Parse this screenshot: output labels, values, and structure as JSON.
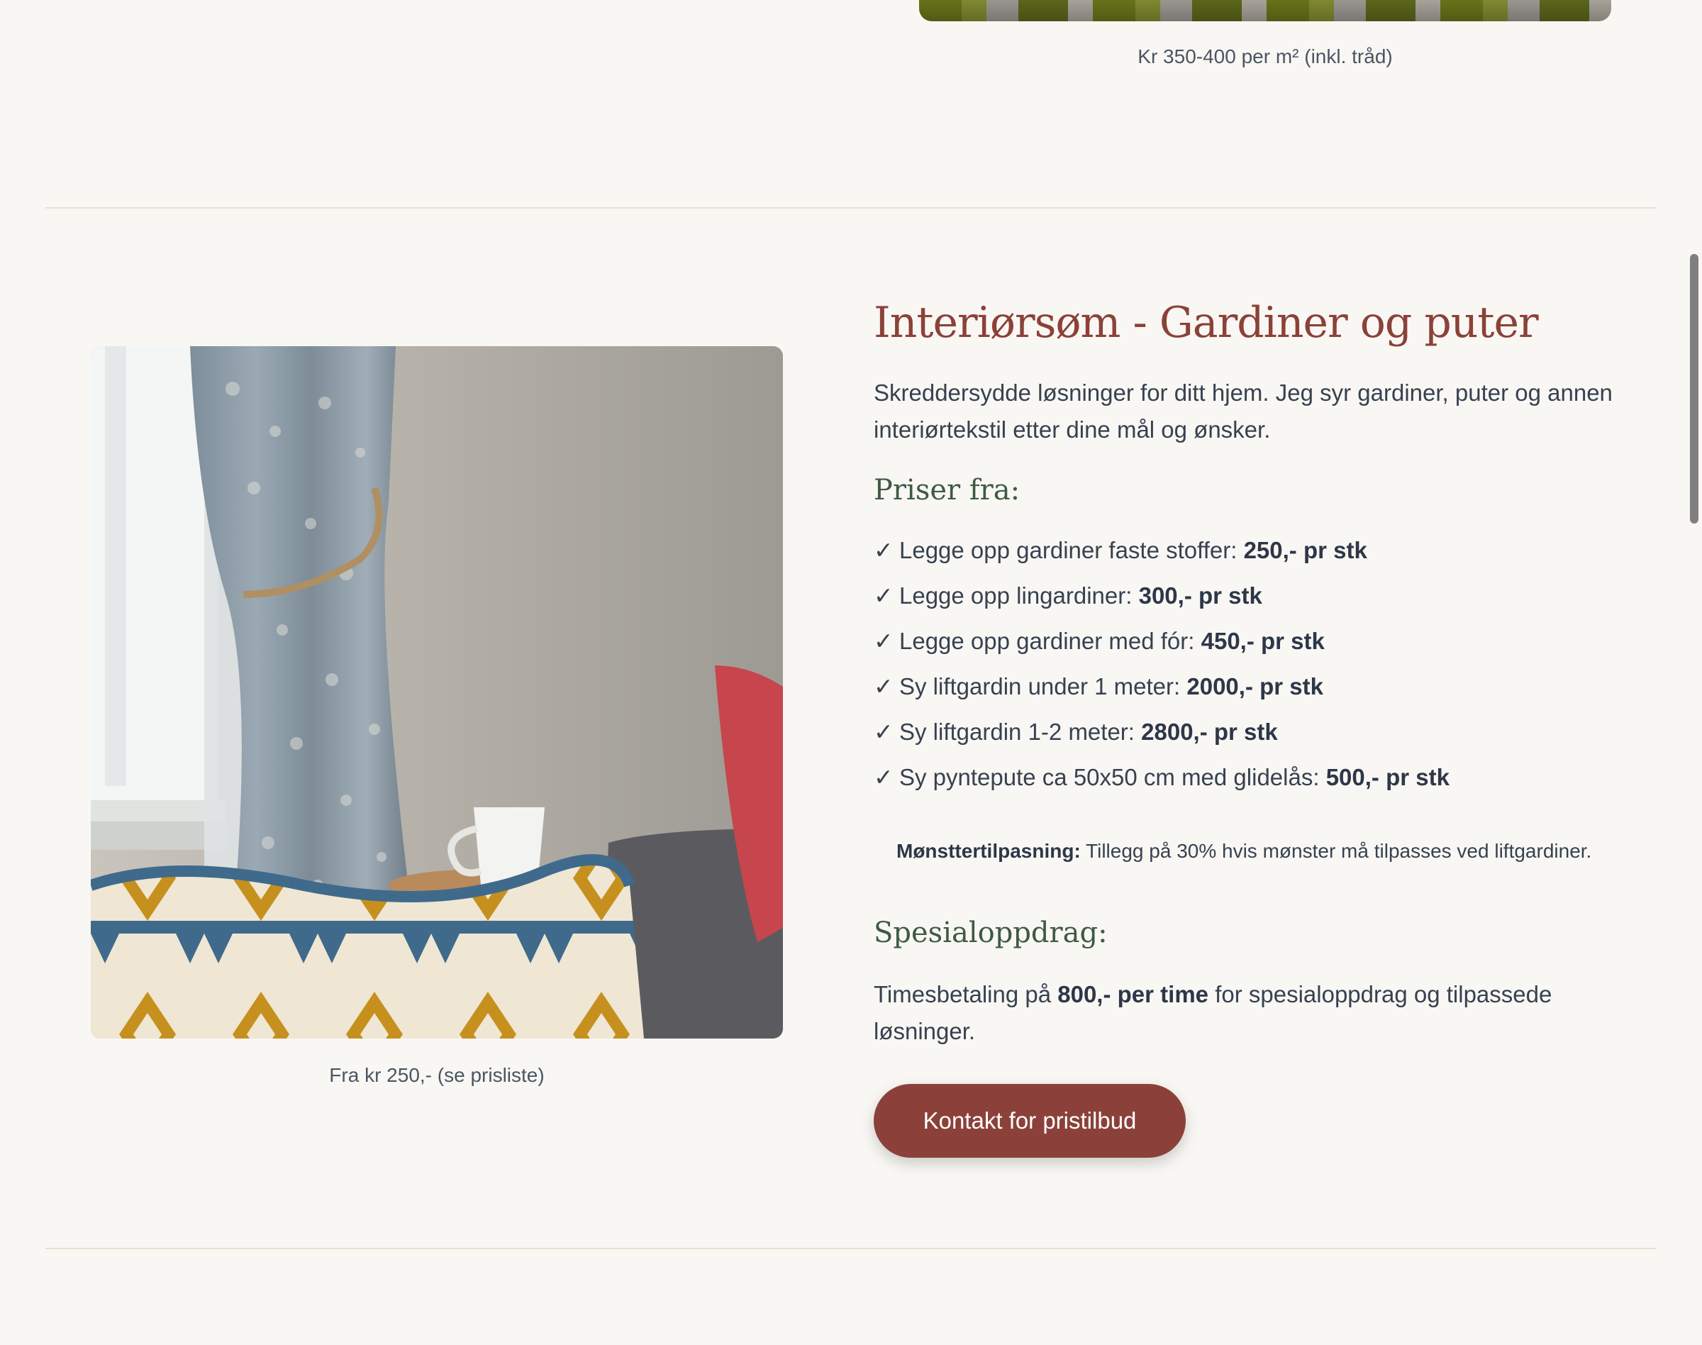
{
  "previous_section": {
    "caption": "Kr 350-400 per m² (inkl. tråd)"
  },
  "section": {
    "title": "Interiørsøm - Gardiner og puter",
    "intro": "Skreddersydde løsninger for ditt hjem. Jeg syr gardiner, puter og annen interiørtekstil etter dine mål og ønsker.",
    "image_caption": "Fra kr 250,- (se prisliste)",
    "prices_heading": "Priser fra:",
    "check_glyph": "✓",
    "prices": [
      {
        "label": "Legge opp gardiner faste stoffer:",
        "price": "250,- pr stk"
      },
      {
        "label": "Legge opp lingardiner:",
        "price": "300,- pr stk"
      },
      {
        "label": "Legge opp gardiner med fór:",
        "price": "450,- pr stk"
      },
      {
        "label": "Sy liftgardin under 1 meter:",
        "price": "2000,- pr stk"
      },
      {
        "label": "Sy liftgardin 1-2 meter:",
        "price": "2800,- pr stk"
      },
      {
        "label": "Sy pyntepute ca 50x50 cm med glidelås:",
        "price": "500,- pr stk"
      }
    ],
    "note_label": "Mønsttertilpasning:",
    "note_text": "Tillegg på 30% hvis mønster må tilpasses ved liftgardiner.",
    "special_heading": "Spesialoppdrag:",
    "special_prefix": "Timesbetaling på",
    "special_rate": "800,- per time",
    "special_suffix": "for spesialoppdrag og tilpassede løsninger.",
    "cta_label": "Kontakt for pristilbud"
  },
  "colors": {
    "background": "#f9f7f3",
    "accent": "#8b4139",
    "subheading": "#3f5a43",
    "text": "#374151",
    "divider": "#e9e0d2"
  }
}
